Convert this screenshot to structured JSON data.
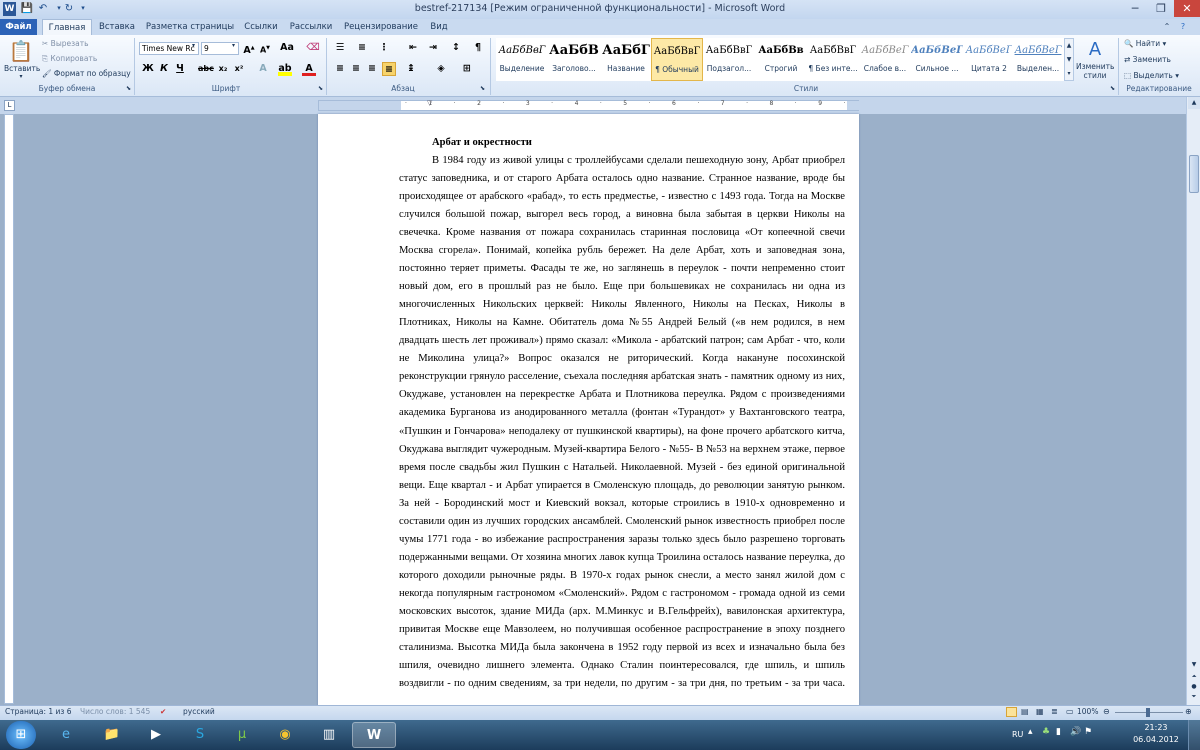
{
  "window": {
    "title": "bestref-217134 [Режим ограниченной функциональности]  -  Microsoft Word"
  },
  "tabs": [
    "Файл",
    "Главная",
    "Вставка",
    "Разметка страницы",
    "Ссылки",
    "Рассылки",
    "Рецензирование",
    "Вид"
  ],
  "clipboard": {
    "paste": "Вставить",
    "cut": "Вырезать",
    "copy": "Копировать",
    "format_painter": "Формат по образцу",
    "group": "Буфер обмена"
  },
  "font": {
    "family": "Times New Rc",
    "size": "9",
    "group": "Шрифт"
  },
  "paragraph": {
    "group": "Абзац"
  },
  "styles": {
    "group": "Стили",
    "items": [
      {
        "sample": "АаБбВвГ",
        "name": "Выделение"
      },
      {
        "sample": "АаБбВ",
        "name": "Заголово..."
      },
      {
        "sample": "АаБбГ",
        "name": "Название"
      },
      {
        "sample": "АаБбВвГ",
        "name": "¶ Обычный"
      },
      {
        "sample": "АаБбВвГ",
        "name": "Подзагол..."
      },
      {
        "sample": "АаБбВв",
        "name": "Строгий"
      },
      {
        "sample": "АаБбВвГ",
        "name": "¶ Без инте..."
      },
      {
        "sample": "АаБбВеГ",
        "name": "Слабое в..."
      },
      {
        "sample": "АаБбВеГ",
        "name": "Сильное ..."
      },
      {
        "sample": "АаБбВеГ",
        "name": "Цитата 2"
      },
      {
        "sample": "АаБбВеГ",
        "name": "Выделен..."
      }
    ],
    "change_styles": "Изменить стили"
  },
  "editing": {
    "find": "Найти",
    "replace": "Заменить",
    "select": "Выделить",
    "group": "Редактирование"
  },
  "document": {
    "title": "Арбат  и окрестности",
    "lines": [
      "В 1984 году из живой улицы с троллейбусами сделали пешеходную зону, Арбат приобрел",
      "статус заповедника, и от старого Арбата осталось одно название. Странное название, вроде бы",
      "происходящее от арабского «рабад», то есть предместье, - известно с 1493 года. Тогда на Москве",
      "случился большой пожар, выгорел весь город, а виновна была забытая в церкви Николы на Песках",
      "свечечка. Кроме названия от пожара сохранилась старинная пословица «От копеечной свечи",
      "Москва сгорела». Понимай, копейка рубль бережет. На деле Арбат, хоть и заповедная зона,",
      "постоянно теряет приметы. Фасады те же, но заглянешь в переулок - почти непременно стоит",
      "новый дом, его в прошлый раз не было. Еще при большевиках не сохранилась ни одна из",
      "многочисленных Никольских церквей: Николы Явленного, Николы на Песках, Николы в",
      "Плотниках, Николы на Камне. Обитатель дома №55 Андрей Белый («в нем родился, в нем",
      "двадцать шесть лет проживал») прямо сказал: «Микола - арбатский патрон; сам Арбат - что, коли",
      "не Миколина улица?» Вопрос оказался не риторический. Когда накануне посохинской",
      "реконструкции грянуло расселение, съехала последняя арбатская знать - памятник одному из них,",
      "Окуджаве, установлен на перекрестке Арбата и Плотникова переулка. Рядом с произведениями",
      "академика Бурганова из анодированного металла (фонтан «Турандот» у Вахтанговского театра,",
      "«Пушкин и Гончарова» неподалеку от пушкинской квартиры), на фоне прочего арбатского китча,",
      "Окуджава выглядит чужеродным. Музей-квартира Белого - №55- В №53 на верхнем этаже, первое",
      "время после свадьбы жил Пушкин с Натальей. Николаевной. Музей - без единой оригинальной",
      "вещи. Еще квартал - и Арбат упирается в Смоленскую площадь, до революции занятую рынком.",
      "За ней - Бородинский мост и Киевский вокзал, которые строились в 1910-х одновременно и",
      "составили один из лучших городских ансамблей. Смоленский рынок известность приобрел после",
      "чумы 1771 года - во избежание распространения заразы только здесь было разрешено торговать",
      "подержанными вещами. От хозяина многих лавок купца Троилина осталось название переулка, до",
      "которого доходили рыночные ряды. В 1970-х годах рынок снесли, а место занял жилой дом с",
      "некогда популярным гастрономом «Смоленский». Рядом с гастрономом - громада одной из семи",
      "московских высоток, здание МИДа (арх. М.Минкус и В.Гельфрейх), вавилонская архитектура,",
      "привитая Москве еще Мавзолеем, но получившая особенное распространение в эпоху позднего",
      "сталинизма. Высотка МИДа была закончена в 1952 году первой из всех и изначально была без",
      "шпиля, очевидно лишнего элемента. Однако Сталин поинтересовался, где шпиль, и шпиль",
      "воздвигли - по одним сведениям, за три недели, по другим - за три дня, по третьим - за три часа."
    ]
  },
  "status": {
    "page": "Страница: 1 из 6",
    "words": "Число слов: 1 545",
    "language": "русский",
    "zoom": "100%"
  },
  "taskbar": {
    "lang": "RU",
    "time": "21:23",
    "date": "06.04.2012"
  },
  "colors": {
    "file_tab": "#2d63b7",
    "accent": "#1e395b"
  }
}
